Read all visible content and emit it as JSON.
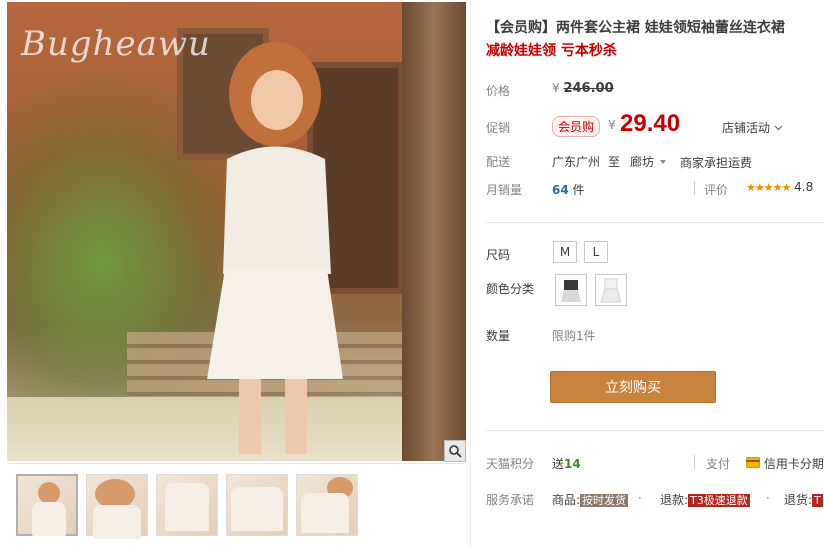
{
  "gallery": {
    "watermark": "Bugheawu",
    "thumbnail_count": 5
  },
  "product": {
    "title": "【会员购】两件套公主裙 娃娃领短袖蕾丝连衣裙",
    "subtitle": "减龄娃娃领 亏本秒杀"
  },
  "price": {
    "label": "价格",
    "currency": "¥",
    "original": "246.00"
  },
  "promo": {
    "label": "促销",
    "badge": "会员购",
    "currency": "¥",
    "price": "29.40",
    "store_activity": "店铺活动"
  },
  "shipping": {
    "label": "配送",
    "from": "广东广州",
    "to_word": "至",
    "destination": "廊坊",
    "fee_note": "商家承担运费"
  },
  "sales": {
    "label": "月销量",
    "count": "64",
    "unit": "件",
    "rating_label": "评价",
    "stars": "★★★★★",
    "rating_value": "4.8"
  },
  "sku": {
    "size_label": "尺码",
    "sizes": [
      "M",
      "L"
    ],
    "color_label": "颜色分类",
    "quantity_label": "数量",
    "limit_text": "限购1件"
  },
  "actions": {
    "buy_label": "立刻购买"
  },
  "points": {
    "label": "天猫积分",
    "give": "送",
    "amount": "14",
    "pay_label": "支付",
    "pay_method": "信用卡分期"
  },
  "service": {
    "label": "服务承诺",
    "item1_prefix": "商品:",
    "item1_tag": "按时发货",
    "item2_prefix": "退款:",
    "item2_tag": "T3极速退款",
    "item3_prefix": "退货:",
    "item3_tag": "T"
  },
  "colors": {
    "accent_red": "#c40000",
    "buy_orange": "#c8833e"
  }
}
